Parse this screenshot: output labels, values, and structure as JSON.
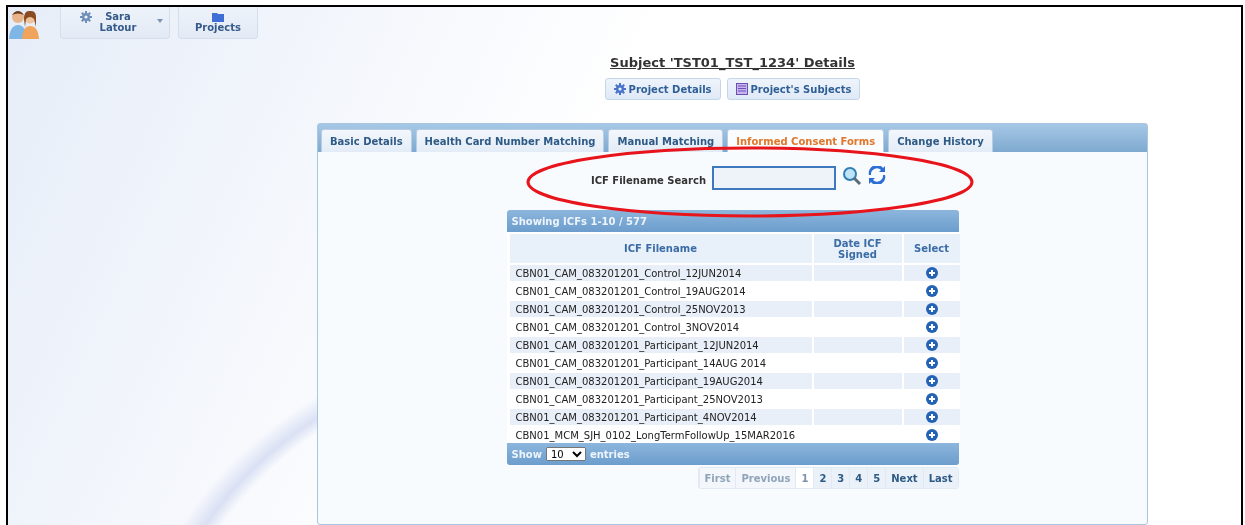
{
  "top_bar": {
    "user_menu": {
      "label": "Sara Latour"
    },
    "projects": {
      "label": "Projects"
    }
  },
  "title": "Subject 'TST01_TST_1234' Details",
  "actions": [
    {
      "kind": "gear",
      "label": "Project Details"
    },
    {
      "kind": "list",
      "label": "Project's Subjects"
    }
  ],
  "tabs": [
    {
      "label": "Basic Details",
      "selected": false
    },
    {
      "label": "Health Card Number Matching",
      "selected": false
    },
    {
      "label": "Manual Matching",
      "selected": false
    },
    {
      "label": "Informed Consent Forms",
      "selected": true
    },
    {
      "label": "Change History",
      "selected": false
    }
  ],
  "search": {
    "label": "ICF Filename Search"
  },
  "table": {
    "caption": "Showing ICFs 1-10 / 577",
    "columns": [
      "ICF Filename",
      "Date ICF Signed",
      "Select"
    ],
    "rows": [
      {
        "filename": "CBN01_CAM_083201201_Control_12JUN2014"
      },
      {
        "filename": "CBN01_CAM_083201201_Control_19AUG2014"
      },
      {
        "filename": "CBN01_CAM_083201201_Control_25NOV2013"
      },
      {
        "filename": "CBN01_CAM_083201201_Control_3NOV2014"
      },
      {
        "filename": "CBN01_CAM_083201201_Participant_12JUN2014"
      },
      {
        "filename": "CBN01_CAM_083201201_Participant_14AUG 2014"
      },
      {
        "filename": "CBN01_CAM_083201201_Participant_19AUG2014"
      },
      {
        "filename": "CBN01_CAM_083201201_Participant_25NOV2013"
      },
      {
        "filename": "CBN01_CAM_083201201_Participant_4NOV2014"
      },
      {
        "filename": "CBN01_MCM_SJH_0102_LongTermFollowUp_15MAR2016"
      }
    ],
    "footer": {
      "show": "Show",
      "page_size": "10",
      "entries": "entries"
    }
  },
  "pagination": [
    {
      "label": "First",
      "disabled": true,
      "selected": false
    },
    {
      "label": "Previous",
      "disabled": true,
      "selected": false
    },
    {
      "label": "1",
      "disabled": false,
      "selected": true
    },
    {
      "label": "2",
      "disabled": false,
      "selected": false
    },
    {
      "label": "3",
      "disabled": false,
      "selected": false
    },
    {
      "label": "4",
      "disabled": false,
      "selected": false
    },
    {
      "label": "5",
      "disabled": false,
      "selected": false
    },
    {
      "label": "Next",
      "disabled": false,
      "selected": false
    },
    {
      "label": "Last",
      "disabled": false,
      "selected": false
    }
  ]
}
